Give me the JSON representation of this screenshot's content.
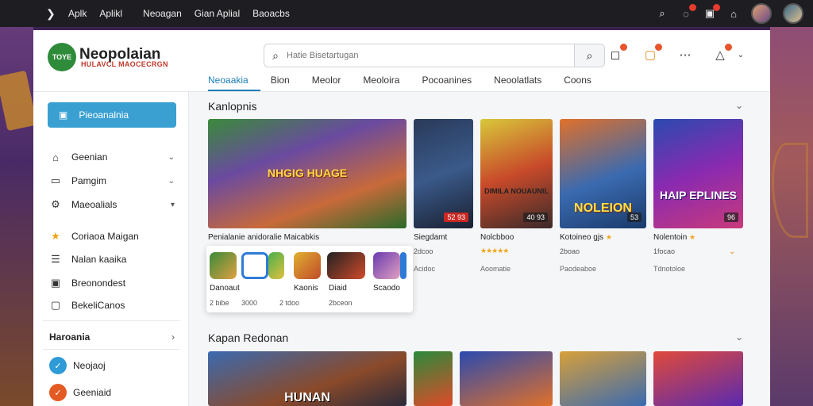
{
  "os_bar": {
    "items": [
      "Aplk",
      "Aplikl",
      "Neoagan",
      "Gian Aplial",
      "Baoacbs"
    ]
  },
  "header": {
    "brand_badge": "TOYE",
    "brand_name": "Neopolaian",
    "brand_sub": "HULAVCL MAOCECRGN",
    "search_placeholder": "Hatie Bisetartugan",
    "tabs": [
      "Neoaakia",
      "Bion",
      "Meolor",
      "Meoloira",
      "Pocoanines",
      "Neoolatlats",
      "Coons"
    ]
  },
  "sidebar": {
    "primary_button": "Pieoanalnia",
    "nav": [
      {
        "label": "Geenian",
        "icon": "home-icon"
      },
      {
        "label": "Pamgim",
        "icon": "calendar-icon"
      },
      {
        "label": "Maeoalials",
        "icon": "settings-icon"
      },
      {
        "label": "Coriaoa Maigan",
        "icon": "star-icon"
      },
      {
        "label": "Nalan kaaika",
        "icon": "list-icon"
      },
      {
        "label": "Breonondest",
        "icon": "image-icon"
      },
      {
        "label": "BekeliCanos",
        "icon": "folder-icon"
      }
    ],
    "section_title": "Haroania",
    "section_items": [
      {
        "label": "Neojaoj",
        "color": "#2e9bd6"
      },
      {
        "label": "Geeniaid",
        "color": "#e35a23"
      }
    ]
  },
  "content": {
    "row1_title": "Kanlopnis",
    "row2_title": "Kapan Redonan",
    "featured": {
      "name": "Penialanie anidoralie Maicabkis",
      "art_text": "NHGIG HUAGE"
    },
    "cards": [
      {
        "name": "Siegdamt",
        "meta": "2dcoo",
        "meta2": "Acidoc",
        "badge": "52 93"
      },
      {
        "name": "Nolcbboo",
        "meta": "★★★★★",
        "meta2": "Aoomatie",
        "badge": "40 93",
        "art_text": "DIMILA NOUAUNIL"
      },
      {
        "name": "Kotoineo gjs",
        "meta": "2boao",
        "meta2": "Paodeaboe",
        "badge": "53",
        "art_text": "NOLEION"
      },
      {
        "name": "Nolentoin",
        "meta": "1focao",
        "meta2": "Tdnotoloe",
        "badge": "96",
        "art_text": "HAIP EPLINES"
      }
    ],
    "popup_apps": [
      {
        "name": "Danoaut",
        "meta": "2 bibe"
      },
      {
        "name": "",
        "meta": "3000"
      },
      {
        "name": "Kaonis",
        "meta": "2 tdoo"
      },
      {
        "name": "Diaid",
        "meta": "2bceon"
      },
      {
        "name": "Scaodo",
        "meta": ""
      }
    ],
    "row2_art_text": "HUNAN"
  }
}
